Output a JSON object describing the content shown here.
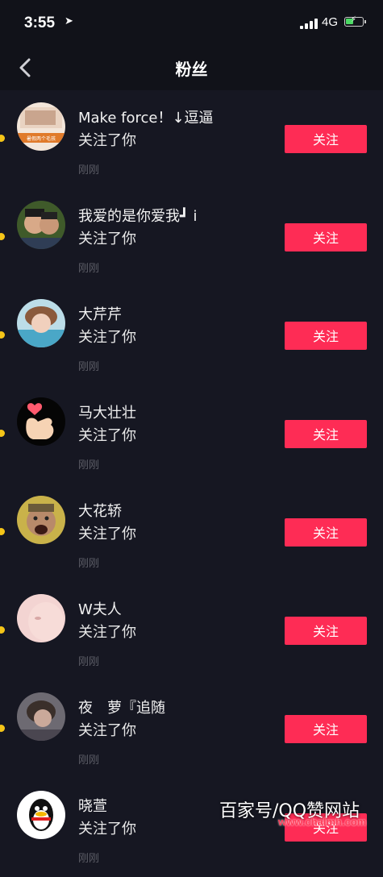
{
  "status_bar": {
    "time": "3:55",
    "network": "4G"
  },
  "nav": {
    "title": "粉丝"
  },
  "followers": [
    {
      "name": "Make force！↓逗逼",
      "action": "关注了你",
      "time": "刚刚",
      "button": "关注",
      "avatar_caption": "暑假两个毛孩"
    },
    {
      "name": "我爱的是你爱我┛ i",
      "action": "关注了你",
      "time": "刚刚",
      "button": "关注"
    },
    {
      "name": "大芹芹",
      "action": "关注了你",
      "time": "刚刚",
      "button": "关注"
    },
    {
      "name": "马大壮壮",
      "action": "关注了你",
      "time": "刚刚",
      "button": "关注"
    },
    {
      "name": "大花轿",
      "action": "关注了你",
      "time": "刚刚",
      "button": "关注"
    },
    {
      "name": "W夫人",
      "action": "关注了你",
      "time": "刚刚",
      "button": "关注"
    },
    {
      "name": "夜　萝『追随",
      "action": "关注了你",
      "time": "刚刚",
      "button": "关注"
    },
    {
      "name": "晓萱",
      "action": "关注了你",
      "time": "刚刚",
      "button": "关注"
    }
  ],
  "watermark": {
    "text": "百家号/QQ赞网站",
    "url": "www.chalmh.com"
  },
  "colors": {
    "background": "#161722",
    "button": "#fe2c55",
    "unread_dot": "#f5c518"
  }
}
